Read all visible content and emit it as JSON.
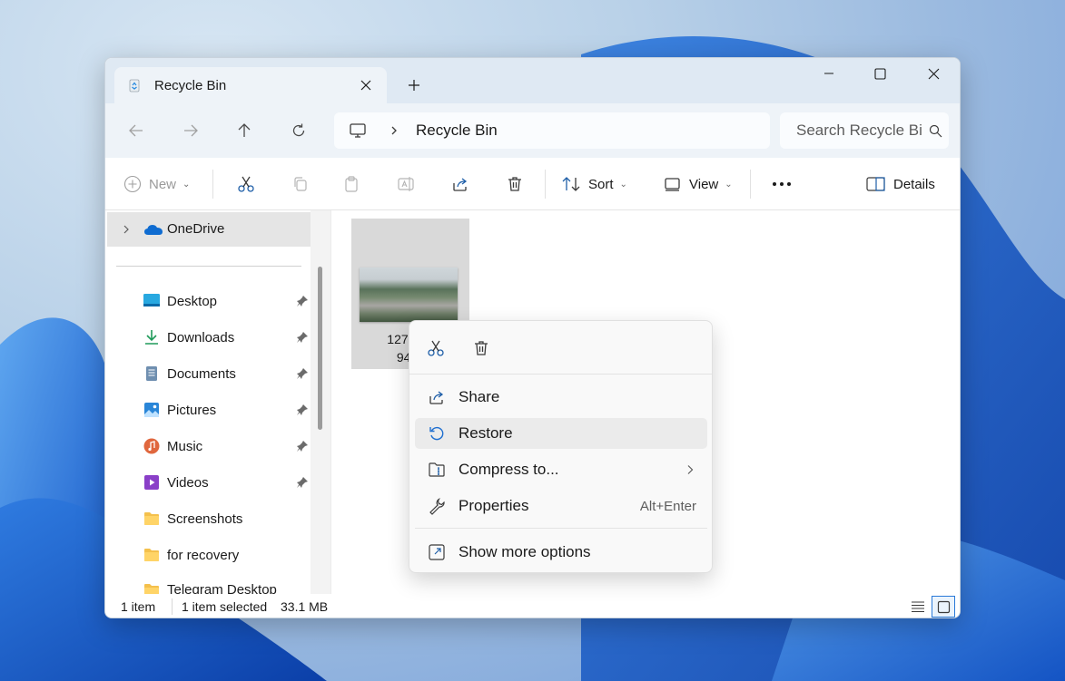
{
  "window": {
    "tab_title": "Recycle Bin",
    "address_path": "Recycle Bin",
    "search_placeholder": "Search Recycle Bin"
  },
  "toolbar": {
    "new_label": "New",
    "sort_label": "Sort",
    "view_label": "View",
    "details_label": "Details"
  },
  "sidebar": {
    "top_item": "OneDrive",
    "items": [
      {
        "label": "Desktop",
        "icon": "desktop-icon",
        "pinned": true
      },
      {
        "label": "Downloads",
        "icon": "downloads-icon",
        "pinned": true
      },
      {
        "label": "Documents",
        "icon": "documents-icon",
        "pinned": true
      },
      {
        "label": "Pictures",
        "icon": "pictures-icon",
        "pinned": true
      },
      {
        "label": "Music",
        "icon": "music-icon",
        "pinned": true
      },
      {
        "label": "Videos",
        "icon": "videos-icon",
        "pinned": true
      },
      {
        "label": "Screenshots",
        "icon": "folder-icon",
        "pinned": false
      },
      {
        "label": "for recovery",
        "icon": "folder-icon",
        "pinned": false
      },
      {
        "label": "Telegram Desktop",
        "icon": "folder-icon",
        "pinned": false
      }
    ]
  },
  "content": {
    "file_name_line1": "127181-",
    "file_name_line2": "94_s"
  },
  "context_menu": {
    "items": [
      {
        "label": "Share",
        "icon": "share-icon"
      },
      {
        "label": "Restore",
        "icon": "restore-icon"
      },
      {
        "label": "Compress to...",
        "icon": "compress-icon"
      },
      {
        "label": "Properties",
        "icon": "wrench-icon",
        "shortcut": "Alt+Enter"
      },
      {
        "label": "Show more options",
        "icon": "show-more-icon"
      }
    ]
  },
  "status": {
    "item_count": "1 item",
    "selection": "1 item selected",
    "size": "33.1 MB"
  },
  "colors": {
    "accent": "#0067c0",
    "titlebar": "#dfe9f3",
    "menu_hover": "#ebebeb"
  }
}
